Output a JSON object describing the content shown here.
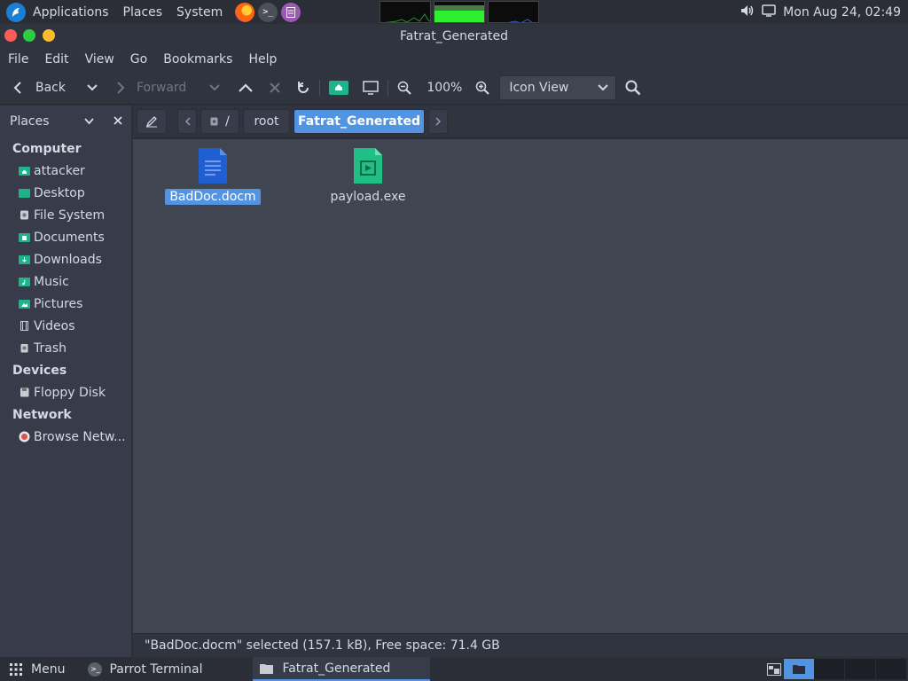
{
  "top_panel": {
    "menus": [
      "Applications",
      "Places",
      "System"
    ],
    "clock": "Mon Aug 24, 02:49"
  },
  "window": {
    "title": "Fatrat_Generated"
  },
  "menubar": [
    "File",
    "Edit",
    "View",
    "Go",
    "Bookmarks",
    "Help"
  ],
  "toolbar": {
    "back": "Back",
    "forward": "Forward",
    "zoom": "100%",
    "view_mode": "Icon View"
  },
  "sidebar": {
    "title": "Places",
    "sections": [
      {
        "name": "Computer",
        "items": [
          "attacker",
          "Desktop",
          "File System",
          "Documents",
          "Downloads",
          "Music",
          "Pictures",
          "Videos",
          "Trash"
        ]
      },
      {
        "name": "Devices",
        "items": [
          "Floppy Disk"
        ]
      },
      {
        "name": "Network",
        "items": [
          "Browse Netw..."
        ]
      }
    ]
  },
  "pathbar": {
    "segments": [
      "/",
      "root",
      "Fatrat_Generated"
    ]
  },
  "files": [
    {
      "name": "BadDoc.docm",
      "icon": "document-icon",
      "selected": true
    },
    {
      "name": "payload.exe",
      "icon": "executable-icon",
      "selected": false
    }
  ],
  "status": "\"BadDoc.docm\" selected (157.1 kB), Free space: 71.4 GB",
  "taskbar": {
    "menu": "Menu",
    "tasks": [
      "Parrot Terminal",
      "Fatrat_Generated"
    ]
  },
  "colors": {
    "accent": "#5294e2",
    "doc_icon": "#1f5fd1",
    "exe_icon": "#1fbf86"
  }
}
